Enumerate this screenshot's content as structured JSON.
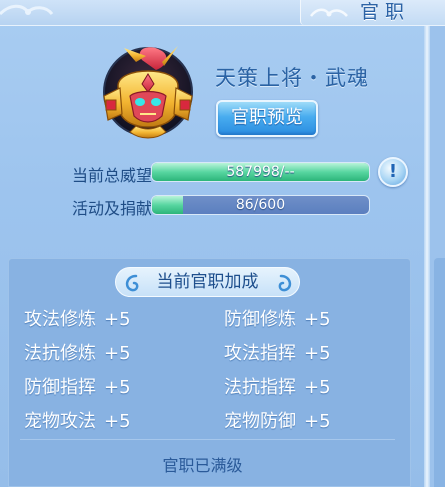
{
  "header": {
    "title": "官职"
  },
  "rank": {
    "name": "天策上将・武魂",
    "preview_button": "官职预览"
  },
  "stats": {
    "prestige": {
      "label": "当前总威望",
      "text": "587998/--",
      "fill": 1.0
    },
    "activity": {
      "label": "活动及捐献",
      "text": "86/600",
      "fill": 0.143
    }
  },
  "bonus": {
    "title": "当前官职加成",
    "items": [
      {
        "name": "攻法修炼",
        "value": "+5"
      },
      {
        "name": "防御修炼",
        "value": "+5"
      },
      {
        "name": "法抗修炼",
        "value": "+5"
      },
      {
        "name": "攻法指挥",
        "value": "+5"
      },
      {
        "name": "防御指挥",
        "value": "+5"
      },
      {
        "name": "法抗指挥",
        "value": "+5"
      },
      {
        "name": "宠物攻法",
        "value": "+5"
      },
      {
        "name": "宠物防御",
        "value": "+5"
      }
    ],
    "status": "官职已满级"
  },
  "icons": {
    "info": "exclamation-icon",
    "avatar": "helmet-icon"
  },
  "colors": {
    "accent": "#2b63a4",
    "bar_green": "#58d6a1",
    "button_blue": "#48acef"
  }
}
